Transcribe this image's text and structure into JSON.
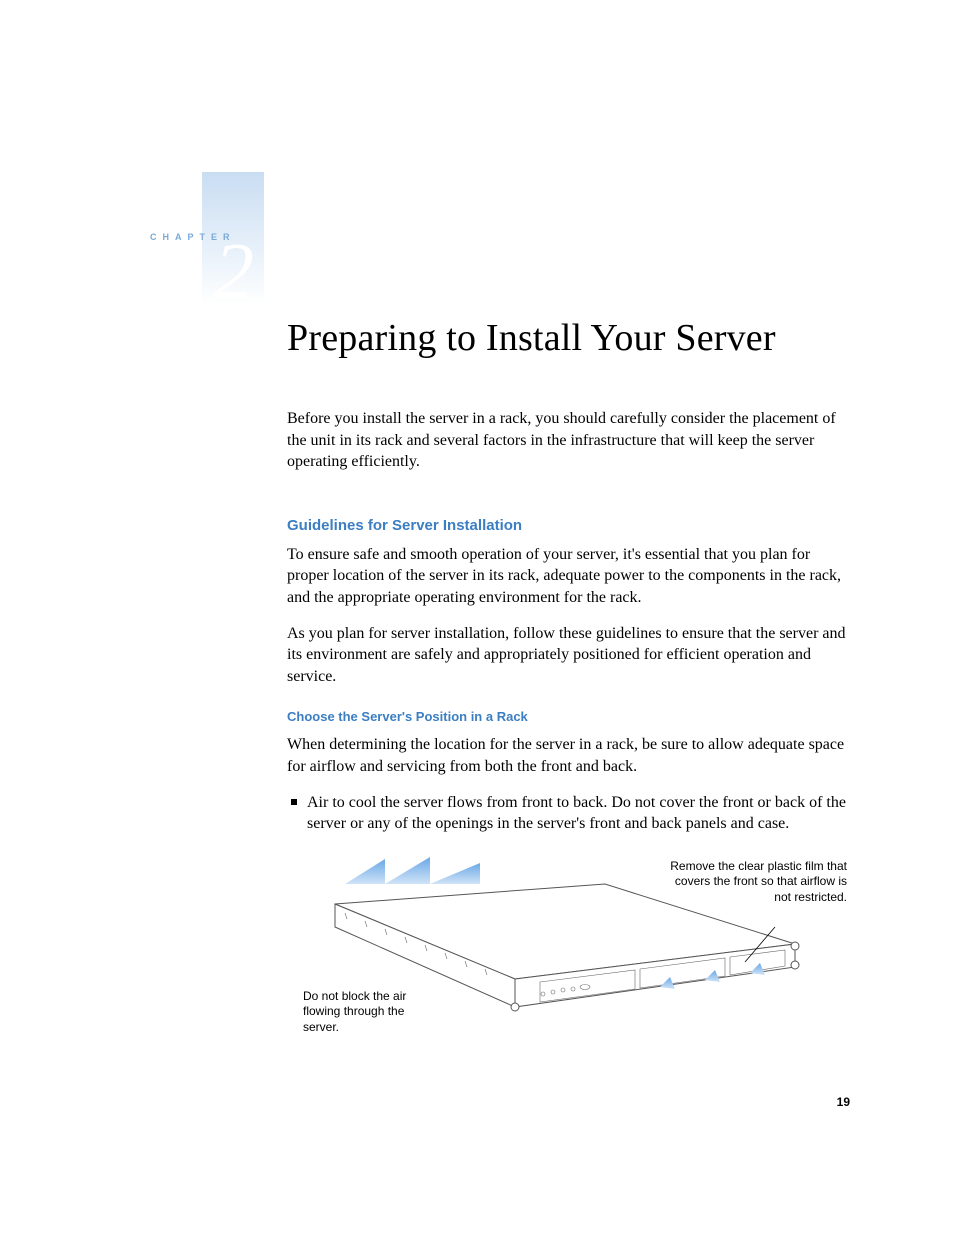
{
  "chapter": {
    "label": "CHAPTER",
    "number": "2"
  },
  "title": "Preparing to Install Your Server",
  "intro": "Before you install the server in a rack, you should carefully consider the placement of the unit in its rack and several factors in the infrastructure that will keep the server operating efficiently.",
  "section1": {
    "heading": "Guidelines for Server Installation",
    "p1": "To ensure safe and smooth operation of your server, it's essential that you plan for proper location of the server in its rack, adequate power to the components in the rack, and the appropriate operating environment for the rack.",
    "p2": "As you plan for server installation, follow these guidelines to ensure that the server and its environment are safely and appropriately positioned for efficient operation and service."
  },
  "section2": {
    "heading": "Choose the Server's Position in a Rack",
    "p1": "When determining the location for the server in a rack, be sure to allow adequate space for airflow and servicing from both the front and back.",
    "bullet1": "Air to cool the server flows from front to back. Do not cover the front or back of the server or any of the openings in the server's front and back panels and case."
  },
  "figure": {
    "callout_left": "Do not block the air flowing through the server.",
    "callout_right": "Remove the clear plastic film that covers the front so that airflow is not restricted."
  },
  "page_number": "19"
}
